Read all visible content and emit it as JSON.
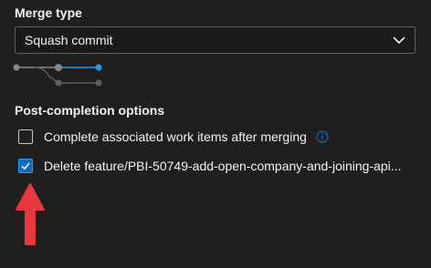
{
  "merge": {
    "title": "Merge type",
    "selected": "Squash commit"
  },
  "post": {
    "title": "Post-completion options",
    "options": [
      {
        "label": "Complete associated work items after merging",
        "checked": false,
        "info_icon": "info-icon"
      },
      {
        "label": "Delete feature/PBI-50749-add-open-company-and-joining-api...",
        "checked": true
      }
    ]
  },
  "colors": {
    "background": "#201f1e",
    "accent": "#0f6cbd",
    "annotation": "#e8373e"
  },
  "icons": {
    "dropdown": "chevron-down-icon",
    "checked": "checkmark-icon",
    "diagram": "squash-commit-diagram-icon",
    "annotation": "red-arrow-up-icon"
  }
}
